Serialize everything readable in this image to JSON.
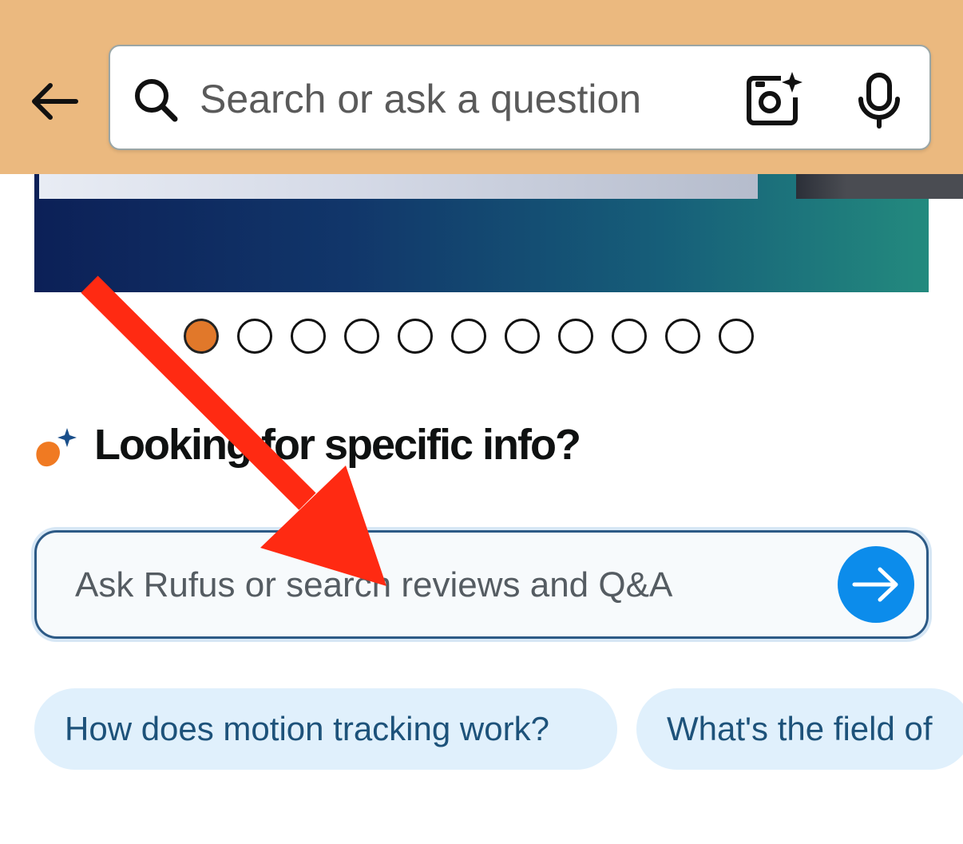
{
  "header": {
    "search": {
      "placeholder": "Search or ask a question"
    },
    "icons": [
      "back-arrow-icon",
      "search-icon",
      "camera-sparkle-icon",
      "microphone-icon"
    ]
  },
  "carousel": {
    "total_slides": 11,
    "active_index": 0,
    "active_color": "#e1782a"
  },
  "rufus": {
    "title": "Looking for specific info?",
    "input_placeholder": "Ask Rufus or search reviews and Q&A",
    "submit_icon": "arrow-right-icon",
    "submit_color": "#0c8ceb",
    "suggestions": [
      {
        "label": "How does motion tracking work?"
      },
      {
        "label": "What's the field of"
      }
    ]
  },
  "colors": {
    "header_bg": "#ebb97f",
    "annotation_arrow": "#ff2a12",
    "chip_bg": "#e0f0fc",
    "chip_text": "#1d527a"
  }
}
